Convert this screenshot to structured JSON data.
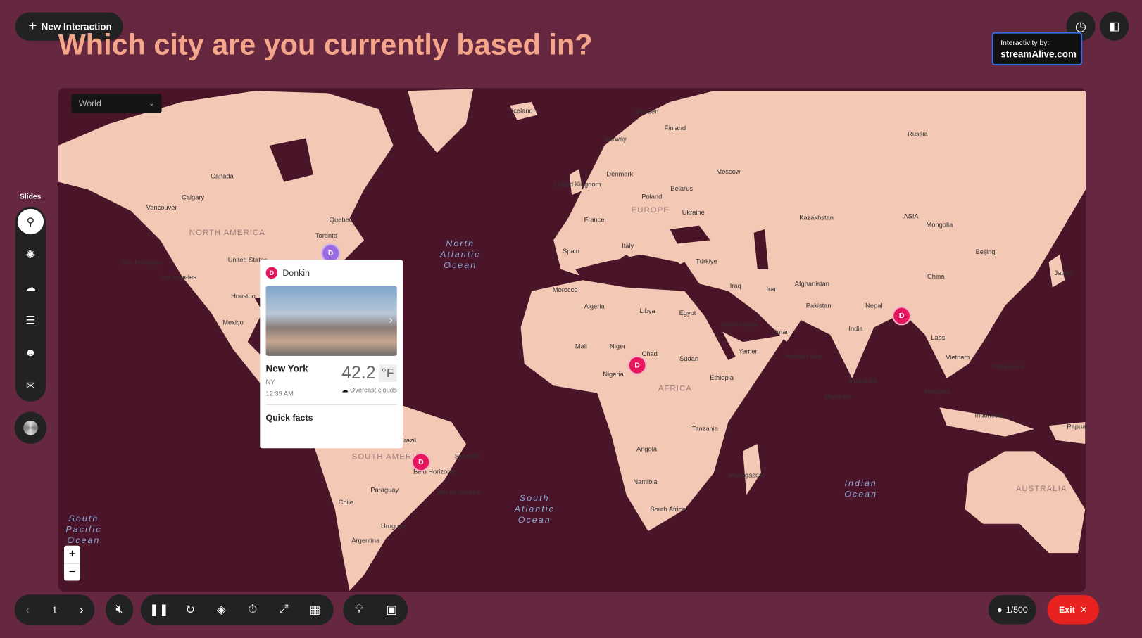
{
  "header": {
    "new_interaction_label": "New Interaction",
    "question": "Which city are you currently based in?",
    "badge_line1": "Interactivity by:",
    "badge_line2": "streamAlive.com"
  },
  "map": {
    "region_select": "World",
    "zoom_in": "+",
    "zoom_out": "−",
    "labels": [
      "Canada",
      "NORTH AMERICA",
      "United States",
      "Mexico",
      "Toronto",
      "Quebec",
      "Calgary",
      "Vancouver",
      "San Francisco",
      "Los Angeles",
      "Houston",
      "Iceland",
      "Sweden",
      "Finland",
      "Norway",
      "Russia",
      "United Kingdom",
      "Denmark",
      "Poland",
      "Belarus",
      "Moscow",
      "Ukraine",
      "France",
      "EUROPE",
      "Spain",
      "Italy",
      "Türkiye",
      "Kazakhstan",
      "Mongolia",
      "ASIA",
      "China",
      "Beijing",
      "Iraq",
      "Iran",
      "Afghanistan",
      "Pakistan",
      "India",
      "Nepal",
      "Saudi Arabia",
      "Egypt",
      "Libya",
      "Algeria",
      "Morocco",
      "Mali",
      "Niger",
      "Chad",
      "Sudan",
      "Nigeria",
      "Ethiopia",
      "AFRICA",
      "Angola",
      "Tanzania",
      "Namibia",
      "South Africa",
      "Madagascar",
      "Arabian Sea",
      "Brazil",
      "SOUTH AMERICA",
      "Paraguay",
      "Chile",
      "Argentina",
      "Uruguay",
      "Belo Horizonte",
      "Rio de Janeiro",
      "Salvador",
      "Vietnam",
      "Philippines",
      "Indonesia",
      "AUSTRALIA",
      "Japan",
      "Laos",
      "Malaysia",
      "Sri Lanka",
      "Maldives",
      "Yemen",
      "Oman",
      "Papua"
    ],
    "oceans": [
      "North Atlantic Ocean",
      "South Atlantic Ocean",
      "Indian Ocean",
      "South Pacific Ocean"
    ],
    "marker_letter": "D",
    "colors": {
      "land": "#f3c8b5",
      "water": "#4a1529",
      "marker": "#e8155f",
      "marker_selected": "#9a6ae0"
    }
  },
  "popup": {
    "user_initial": "D",
    "user_name": "Donkin",
    "city": "New York",
    "state": "NY",
    "time": "12:39 AM",
    "temperature": "42.2",
    "unit": "°F",
    "weather": "Overcast clouds",
    "quick_facts": "Quick facts"
  },
  "sidebar": {
    "title": "Slides",
    "icons": [
      "map-pin-icon",
      "wheel-icon",
      "word-cloud-icon",
      "bar-chart-icon",
      "face-icon",
      "chat-icon"
    ]
  },
  "toolbar": {
    "slide_number": "1",
    "participants": "1/500",
    "exit_label": "Exit"
  },
  "colors": {
    "background": "#652840",
    "title": "#f5a68a",
    "exit": "#e8231f"
  }
}
